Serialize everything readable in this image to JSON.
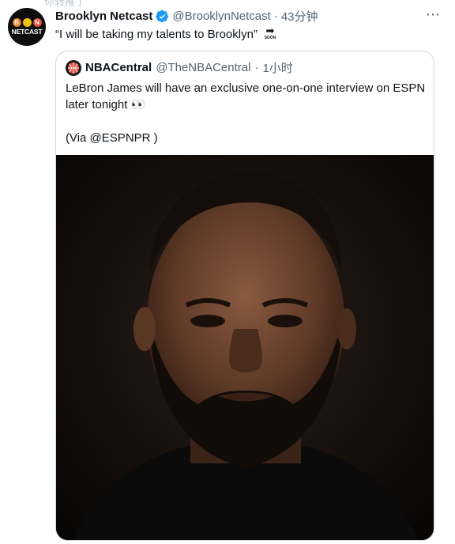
{
  "retweet_header": "你转推了",
  "tweet": {
    "author_name": "Brooklyn Netcast",
    "author_handle": "@BrooklynNetcast",
    "separator": "·",
    "time": "43分钟",
    "text": "“I will be taking my talents to Brooklyn”",
    "soon_label": "SOON",
    "avatar_text": "NETCAST",
    "avatar_letters": [
      "B",
      "O",
      "N"
    ]
  },
  "quoted": {
    "author_name": "NBACentral",
    "author_handle": "@TheNBACentral",
    "separator": "·",
    "time": "1小时",
    "line1": "LeBron James will have an exclusive one-on-one interview on ESPN later tonight 👀",
    "line2": "(Via @ESPNPR )"
  },
  "icons": {
    "verified": "verified-badge-icon",
    "more": "more-options-icon",
    "soon": "soon-arrow-icon",
    "eyes": "eyes-emoji"
  },
  "colors": {
    "verified_blue": "#1d9bf0",
    "muted_text": "#536471",
    "border": "#cfd9de"
  }
}
